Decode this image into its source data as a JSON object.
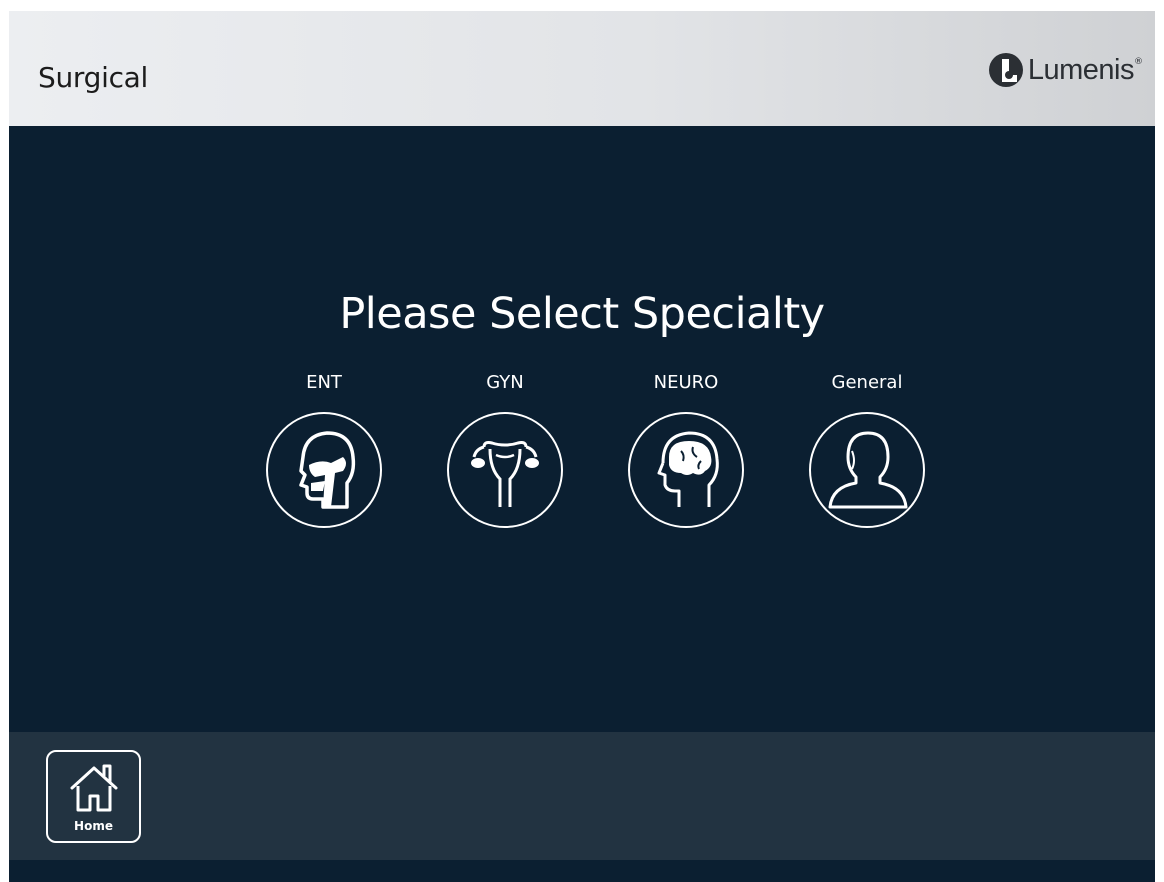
{
  "header": {
    "title": "Surgical",
    "brand": "Lumenis",
    "brand_mark": "®"
  },
  "main": {
    "prompt": "Please Select Specialty",
    "specialties": [
      {
        "label": "ENT",
        "icon": "head-airway-icon"
      },
      {
        "label": "GYN",
        "icon": "uterus-icon"
      },
      {
        "label": "NEURO",
        "icon": "brain-head-icon"
      },
      {
        "label": "General",
        "icon": "person-icon"
      }
    ]
  },
  "footer": {
    "home_label": "Home",
    "home_icon": "house-icon"
  },
  "colors": {
    "background": "#0b1f31",
    "footer": "#223341",
    "header": "#e2e4e7",
    "foreground": "#ffffff"
  }
}
